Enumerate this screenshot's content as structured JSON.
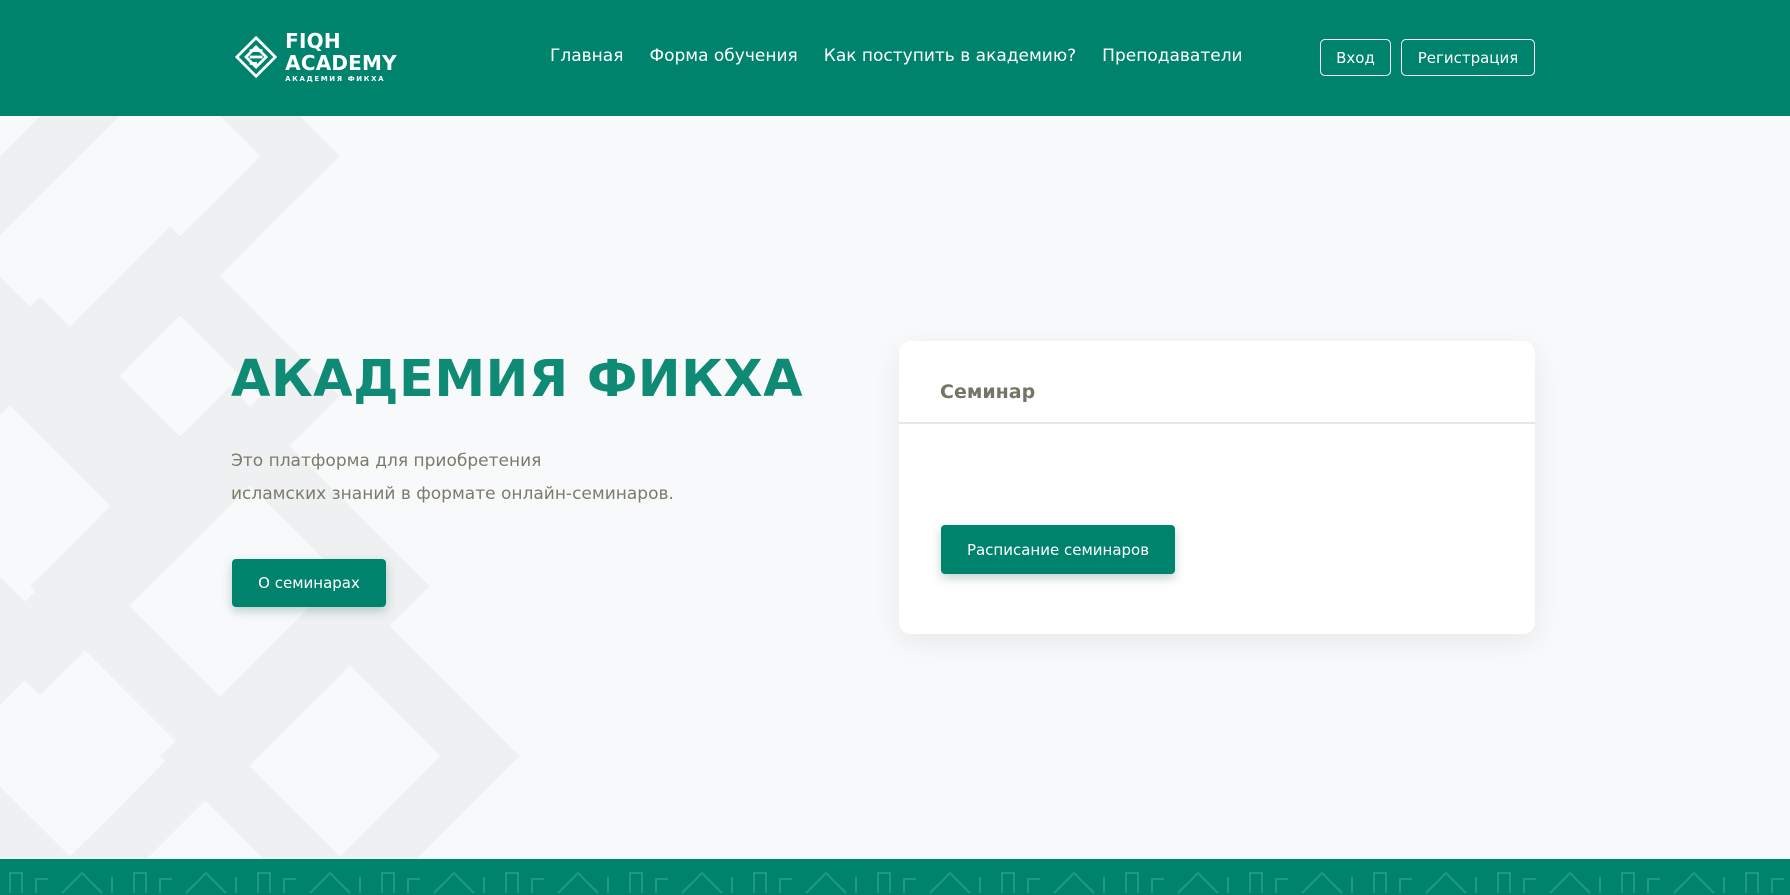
{
  "header": {
    "logo": {
      "title": "FIQH ACADEMY",
      "subtitle": "АКАДЕМИЯ ФИКХА",
      "icon": "fiqh-logo-icon"
    },
    "nav": [
      {
        "label": "Главная"
      },
      {
        "label": "Форма обучения"
      },
      {
        "label": "Как поступить в академию?"
      },
      {
        "label": "Преподаватели"
      }
    ],
    "login_label": "Вход",
    "register_label": "Регистрация"
  },
  "hero": {
    "title": "АКАДЕМИЯ ФИКХА",
    "text_line1": "Это платформа для приобретения",
    "text_line2": "исламских знаний в формате онлайн-семинаров.",
    "button_label": "О семинарах"
  },
  "card": {
    "title": "Семинар",
    "button_label": "Расписание семинаров"
  },
  "colors": {
    "brand": "#00836c",
    "title": "#0f8a74",
    "text": "#7b7b6b",
    "background": "#f8f9fb"
  }
}
